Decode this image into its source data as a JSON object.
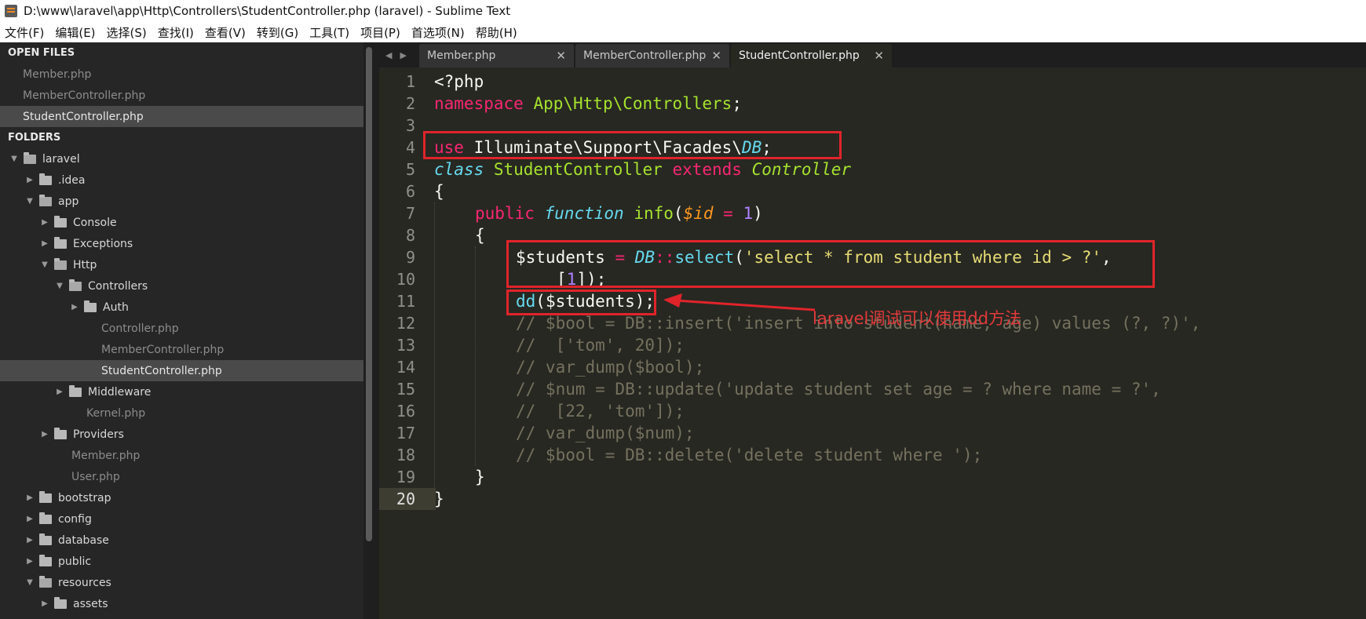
{
  "window": {
    "title": "D:\\www\\laravel\\app\\Http\\Controllers\\StudentController.php (laravel) - Sublime Text"
  },
  "menu": [
    "文件(F)",
    "编辑(E)",
    "选择(S)",
    "查找(I)",
    "查看(V)",
    "转到(G)",
    "工具(T)",
    "项目(P)",
    "首选项(N)",
    "帮助(H)"
  ],
  "sidebar": {
    "open_files_header": "OPEN FILES",
    "open_files": [
      "Member.php",
      "MemberController.php",
      "StudentController.php"
    ],
    "folders_header": "FOLDERS",
    "tree": [
      {
        "label": "laravel",
        "type": "folder",
        "open": true
      },
      {
        "label": ".idea",
        "type": "folder",
        "open": false
      },
      {
        "label": "app",
        "type": "folder",
        "open": true
      },
      {
        "label": "Console",
        "type": "folder",
        "open": false
      },
      {
        "label": "Exceptions",
        "type": "folder",
        "open": false
      },
      {
        "label": "Http",
        "type": "folder",
        "open": true
      },
      {
        "label": "Controllers",
        "type": "folder",
        "open": true
      },
      {
        "label": "Auth",
        "type": "folder",
        "open": false
      },
      {
        "label": "Controller.php",
        "type": "file"
      },
      {
        "label": "MemberController.php",
        "type": "file"
      },
      {
        "label": "StudentController.php",
        "type": "file",
        "active": true
      },
      {
        "label": "Middleware",
        "type": "folder",
        "open": false
      },
      {
        "label": "Kernel.php",
        "type": "file"
      },
      {
        "label": "Providers",
        "type": "folder",
        "open": false
      },
      {
        "label": "Member.php",
        "type": "file"
      },
      {
        "label": "User.php",
        "type": "file"
      },
      {
        "label": "bootstrap",
        "type": "folder",
        "open": false
      },
      {
        "label": "config",
        "type": "folder",
        "open": false
      },
      {
        "label": "database",
        "type": "folder",
        "open": false
      },
      {
        "label": "public",
        "type": "folder",
        "open": false
      },
      {
        "label": "resources",
        "type": "folder",
        "open": true
      },
      {
        "label": "assets",
        "type": "folder",
        "open": false
      }
    ]
  },
  "tabs": [
    {
      "label": "Member.php",
      "active": false
    },
    {
      "label": "MemberController.php",
      "active": false
    },
    {
      "label": "StudentController.php",
      "active": true
    }
  ],
  "editor": {
    "line_numbers": [
      "1",
      "2",
      "3",
      "4",
      "5",
      "6",
      "7",
      "8",
      "9",
      "10",
      "11",
      "12",
      "13",
      "14",
      "15",
      "16",
      "17",
      "18",
      "19",
      "20"
    ],
    "current_line": "20",
    "annotation": "laravel调试可以使用dd方法",
    "tokens": {
      "l1": [
        "<?php"
      ],
      "l2": [
        "namespace",
        " App\\Http\\Controllers",
        ";"
      ],
      "l4": [
        "use",
        " Illuminate\\Support\\Facades\\",
        "DB",
        ";"
      ],
      "l5": [
        "class",
        " StudentController ",
        "extends",
        " ",
        "Controller"
      ],
      "l6": [
        "{"
      ],
      "l7": [
        "public",
        " ",
        "function",
        " ",
        "info",
        "(",
        "$id",
        " ",
        "=",
        " ",
        "1",
        ")"
      ],
      "l8": [
        "{"
      ],
      "l9": [
        "$students",
        " ",
        "=",
        " ",
        "DB",
        "::",
        "select",
        "(",
        "'select * from student where id > ?'",
        ","
      ],
      "l10": [
        "[",
        "1",
        "]);"
      ],
      "l11": [
        "dd",
        "($students);"
      ],
      "l12": [
        "// $bool = DB::insert('insert into student(name, age) values (?, ?)',"
      ],
      "l13": [
        "//  ['tom', 20]);"
      ],
      "l14": [
        "// var_dump($bool);"
      ],
      "l15": [
        "// $num = DB::update('update student set age = ? where name = ?',"
      ],
      "l16": [
        "//  [22, 'tom']);"
      ],
      "l17": [
        "// var_dump($num);"
      ],
      "l18": [
        "// $bool = DB::delete('delete student where ');"
      ],
      "l19": [
        "}"
      ],
      "l20": [
        "}"
      ]
    }
  },
  "colors": {
    "keyword": "#f92672",
    "storage": "#66d9ef",
    "function": "#a6e22e",
    "variable": "#fd971f",
    "number": "#ae81ff",
    "string": "#e6db74",
    "comment": "#75715e",
    "highlight_box": "#e0242a"
  }
}
